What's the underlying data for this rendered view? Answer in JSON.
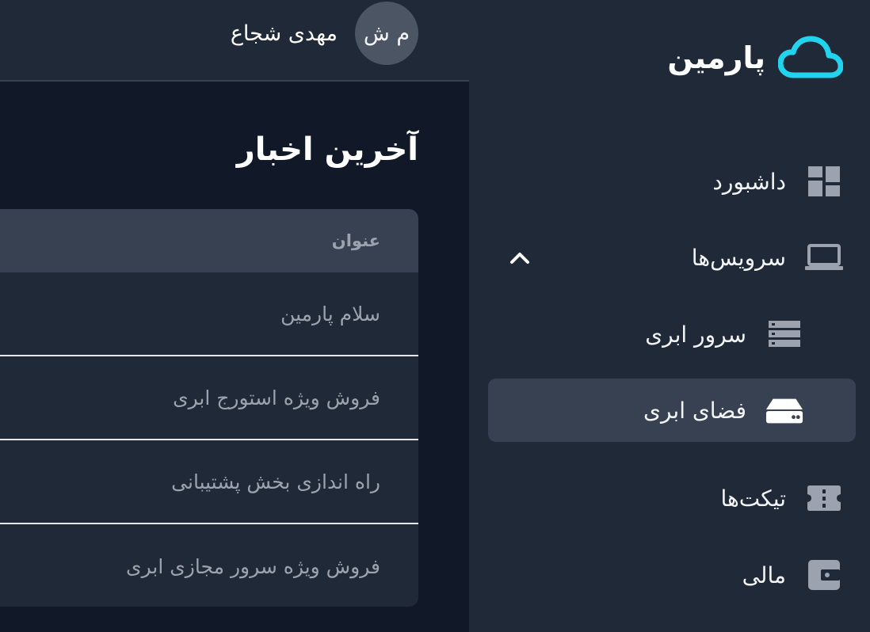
{
  "brand": {
    "name": "پارمین",
    "logo_icon": "cloud-icon",
    "accent": "#22d3ee"
  },
  "user": {
    "initials": "م ش",
    "name": "مهدی شجاع"
  },
  "sidebar": {
    "items": [
      {
        "label": "داشبورد",
        "icon": "dashboard-icon"
      },
      {
        "label": "سرویس‌ها",
        "icon": "laptop-icon",
        "expanded": true
      },
      {
        "label": "سرور ابری",
        "icon": "server-icon"
      },
      {
        "label": "فضای ابری",
        "icon": "hard-drive-icon",
        "active": true
      },
      {
        "label": "تیکت‌ها",
        "icon": "ticket-icon"
      },
      {
        "label": "مالی",
        "icon": "wallet-icon"
      }
    ]
  },
  "news": {
    "title": "آخرین اخبار",
    "column_header": "عنوان",
    "rows": [
      "سلام پارمین",
      "فروش ویژه استورج ابری",
      "راه اندازی بخش پشتیبانی",
      "فروش ویژه سرور مجازی ابری"
    ]
  }
}
